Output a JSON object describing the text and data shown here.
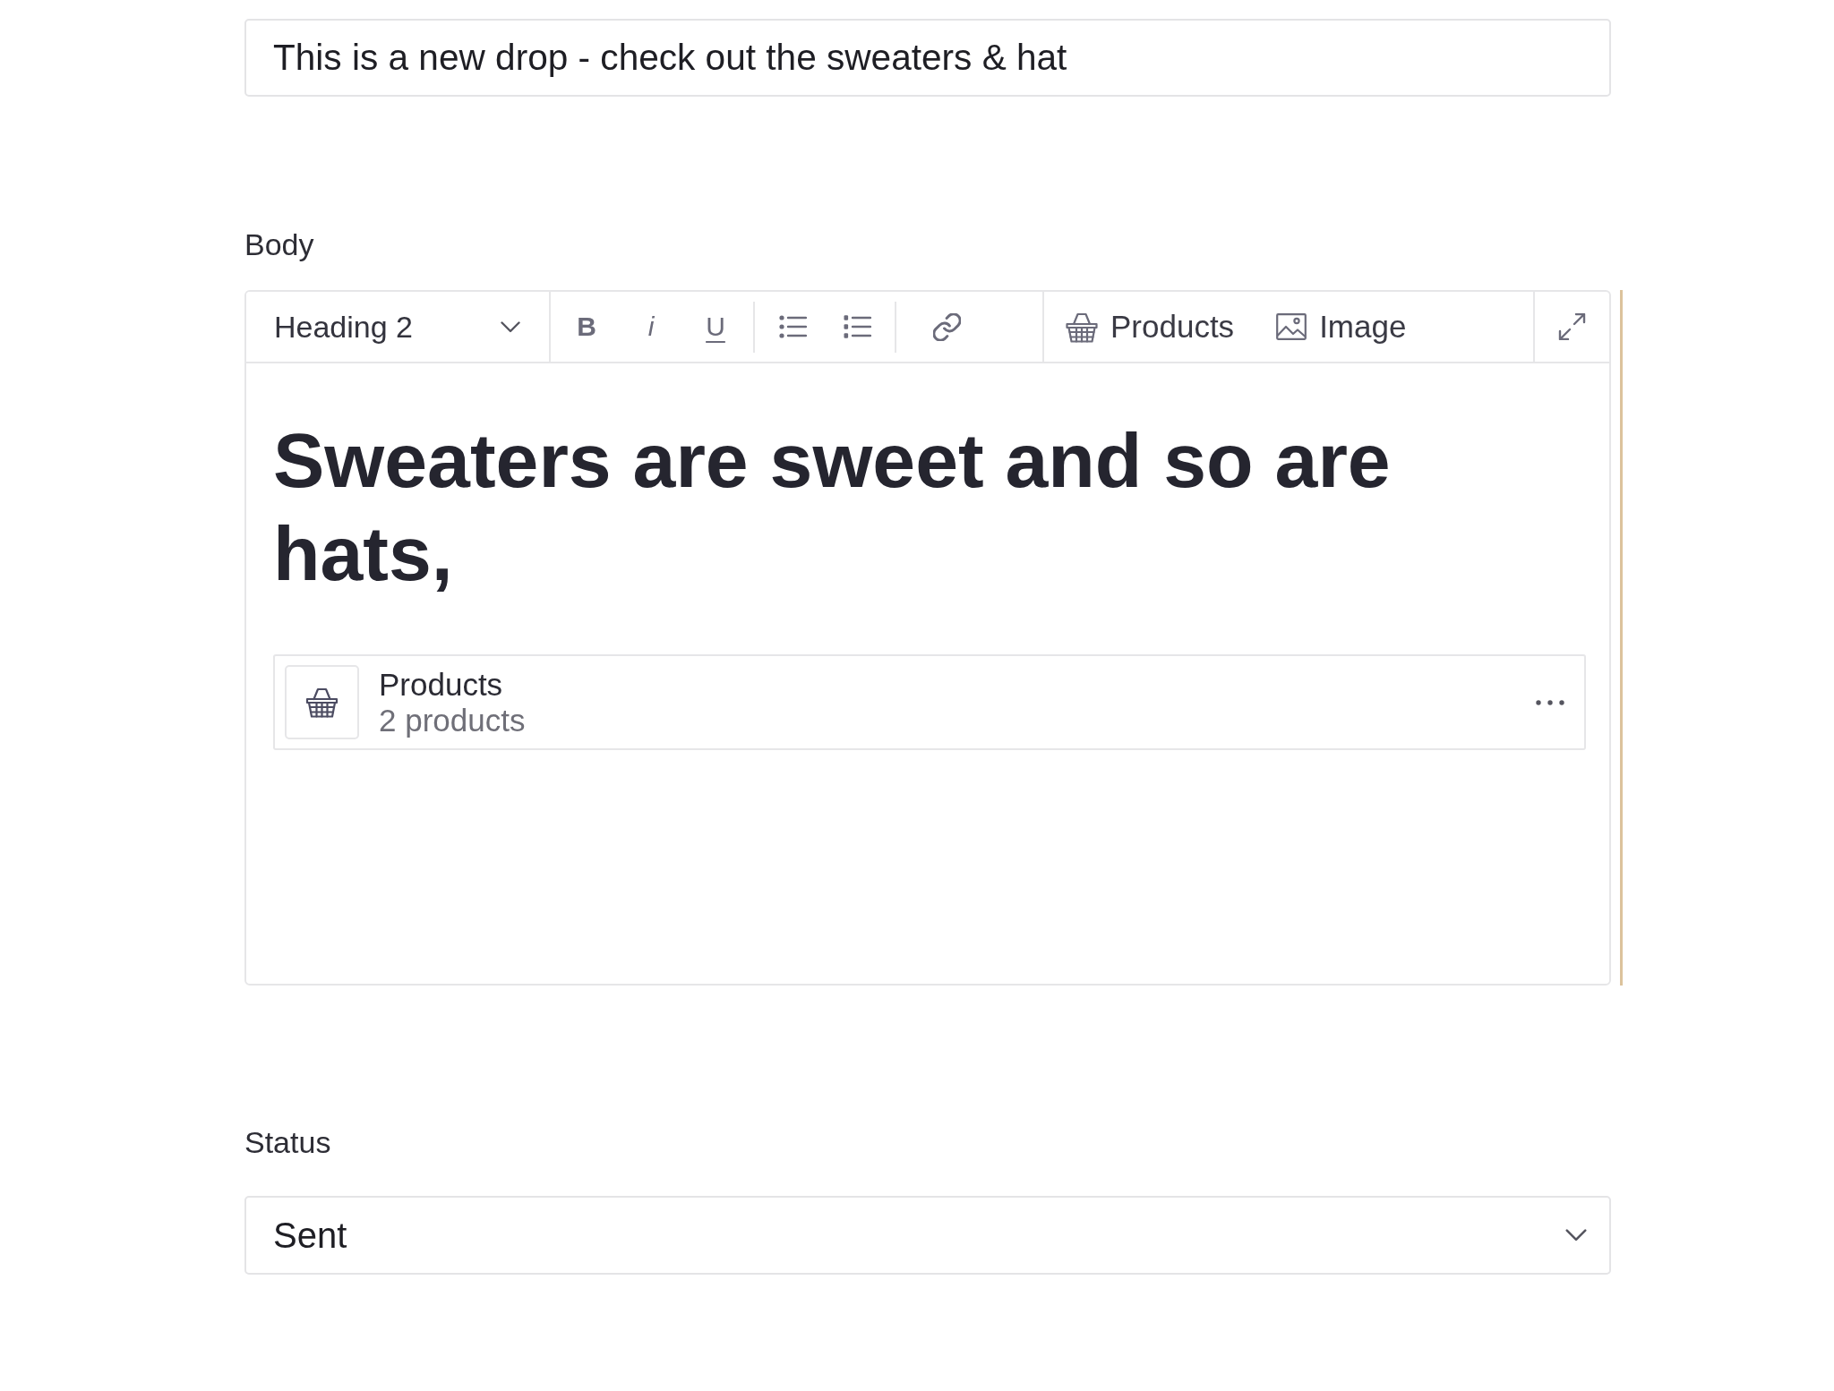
{
  "subject_field": {
    "value": "This is a new drop - check out the sweaters & hat"
  },
  "body": {
    "label": "Body",
    "toolbar": {
      "block_format": {
        "value": "Heading 2"
      },
      "sections": [
        [
          [
            {
              "kind": "bold",
              "label": "B"
            },
            {
              "kind": "italic",
              "label": "i"
            },
            {
              "kind": "underline",
              "label": "U"
            }
          ],
          [
            {
              "kind": "bullet_list"
            },
            {
              "kind": "numbered_list"
            }
          ],
          [
            {
              "kind": "link"
            }
          ]
        ],
        [
          [
            {
              "kind": "products",
              "label": "Products"
            },
            {
              "kind": "image",
              "label": "Image"
            }
          ]
        ],
        [
          [
            {
              "kind": "fullscreen"
            }
          ]
        ]
      ]
    },
    "content": {
      "heading": "Sweaters are sweet and so are hats,",
      "embeds": [
        {
          "title": "Products",
          "subtitle": "2 products"
        }
      ]
    }
  },
  "status": {
    "label": "Status",
    "value": "Sent"
  }
}
